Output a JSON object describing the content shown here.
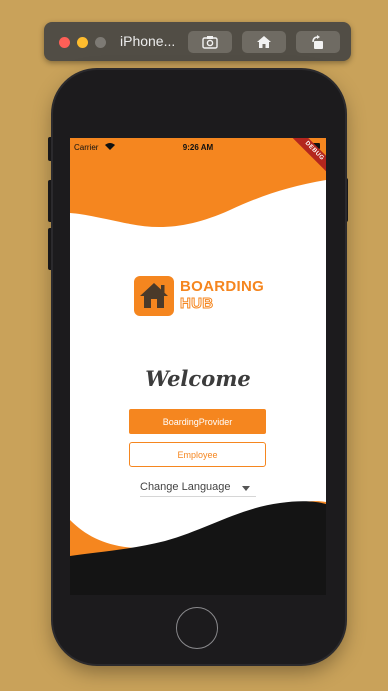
{
  "simulator": {
    "title": "iPhone...",
    "buttons": [
      {
        "icon": "camera-icon"
      },
      {
        "icon": "home-icon"
      },
      {
        "icon": "rotate-icon"
      }
    ]
  },
  "status_bar": {
    "carrier": "Carrier",
    "time": "9:26 AM"
  },
  "debug_banner": "DEBUG",
  "logo": {
    "word1": "BOARDING",
    "word2": "HUB",
    "icon": "house-icon"
  },
  "welcome": "Welcome",
  "buttons": {
    "provider": "BoardingProvider",
    "employee": "Employee"
  },
  "language": {
    "label": "Change Language",
    "icon": "chevron-down-icon"
  },
  "colors": {
    "accent": "#f5861f",
    "background": "#c9a25a",
    "phone_frame": "#1c1b1d",
    "bottom_wave": "#141414"
  }
}
